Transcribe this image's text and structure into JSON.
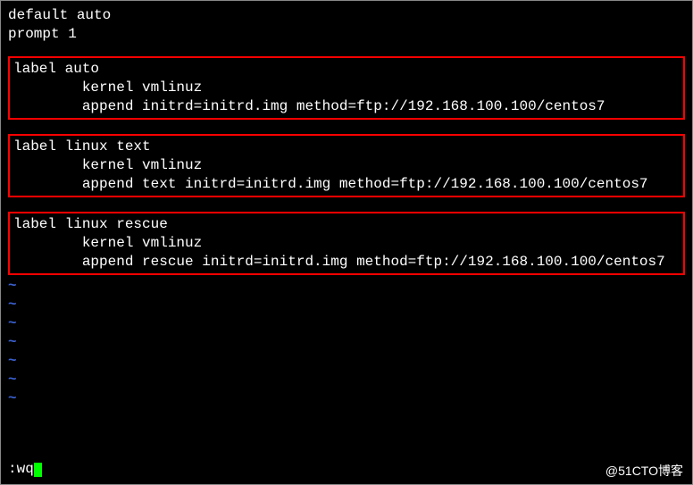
{
  "header": {
    "line1": "default auto",
    "line2": "prompt 1"
  },
  "blocks": [
    {
      "label": "label auto",
      "kernel": "        kernel vmlinuz",
      "append": "        append initrd=initrd.img method=ftp://192.168.100.100/centos7"
    },
    {
      "label": "label linux text",
      "kernel": "        kernel vmlinuz",
      "append": "        append text initrd=initrd.img method=ftp://192.168.100.100/centos7"
    },
    {
      "label": "label linux rescue",
      "kernel": "        kernel vmlinuz",
      "append": "        append rescue initrd=initrd.img method=ftp://192.168.100.100/centos7"
    }
  ],
  "tilde": "~",
  "cmd": ":wq",
  "watermark": "@51CTO博客"
}
